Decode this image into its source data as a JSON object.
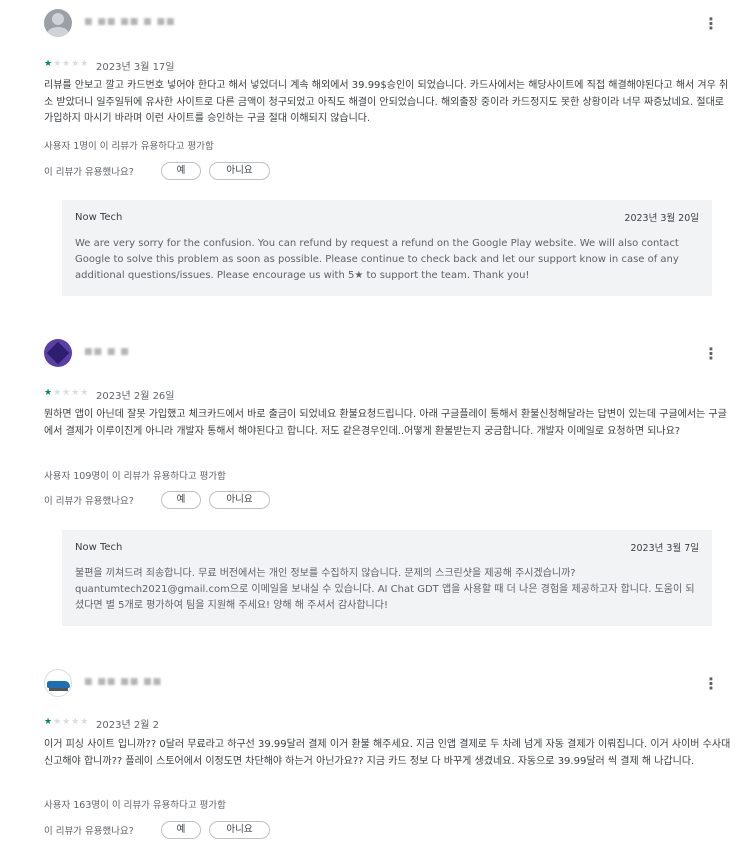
{
  "reviews": [
    {
      "username": "■ ■■ ■■ ■ ■■",
      "rating": 1,
      "date": "2023년 3월 17일",
      "text": "리뷰를 안보고 깔고 카드번호 넣어야 한다고 해서 넣었더니 계속 해외에서 39.99$승인이 되었습니다. 카드사에서는 해당사이트에 직접 해결해야된다고 해서 겨우 취소 받았더니 일주일뒤에 유사한 사이트로 다른 금액이 청구되었고 아직도 해결이 안되었습니다. 해외출장 중이라 카드정지도 못한 상황이라 너무 짜증났네요. 절대로 가입하지 마시기 바라며 이런 사이트를 승인하는 구글 절대 이해되지 않습니다.",
      "helpful_count_text": "사용자 1명이 이 리뷰가 유용하다고 평가함",
      "helpful_question": "이 리뷰가 유용했나요?",
      "yes_label": "예",
      "no_label": "아니요",
      "reply": {
        "developer": "Now Tech",
        "date": "2023년 3월 20일",
        "text": "We are very sorry for the confusion. You can refund by request a refund on the Google Play website. We will also contact Google to solve this problem as soon as possible. Please continue to check back and let our support know in case of any additional questions/issues. Please encourage us with 5★ to support the team. Thank you!"
      }
    },
    {
      "username": "■■ ■ ■",
      "rating": 1,
      "date": "2023년 2월 26일",
      "text": "뭔하면 앱이 아닌데 잘못 가입했고 체크카드에서 바로 출금이 되었네요 환불요청드립니다. 아래 구글플레이 통해서 환불신청해달라는 답변이 있는데 구글에서는 구글에서 결제가 이루이진게 아니라 개발자 통해서 해야된다고 합니다. 저도 같은경우인데..어떻게 환불받는지 궁금합니다. 개발자 이메일로 요청하면 되나요?",
      "helpful_count_text": "사용자 109명이 이 리뷰가 유용하다고 평가함",
      "helpful_question": "이 리뷰가 유용했나요?",
      "yes_label": "예",
      "no_label": "아니요",
      "reply": {
        "developer": "Now Tech",
        "date": "2023년 3월 7일",
        "text": "불편을 끼쳐드려 죄송합니다. 무료 버전에서는 개인 정보를 수집하지 않습니다. 문제의 스크린샷을 제공해 주시겠습니까? quantumtech2021@gmail.com으로 이메일을 보내실 수 있습니다. AI Chat GDT 앱을 사용할 때 더 나은 경험을 제공하고자 합니다. 도움이 되셨다면 별 5개로 평가하여 팀을 지원해 주세요! 양해 해 주셔서 감사합니다!"
      }
    },
    {
      "username": "■ ■■ ■■ ■■",
      "rating": 1,
      "date": "2023년 2월 2",
      "text": "이거 피싱 사이트 입니까?? 0달러 무료라고 하구선 39.99달러 결제 이거 환불 해주세요. 지금 인앱 결제로 두 차례 넘게 자동 결제가 이뤄집니다. 이거 사이버 수사대 신고해야 합니까?? 플레이 스토어에서 이정도면 차단해야 하는거 아닌가요?? 지금 카드 정보 다 바꾸게 생겼네요. 자동으로 39.99달러 씩 결제 해 나갑니다.",
      "helpful_count_text": "사용자 163명이 이 리뷰가 유용하다고 평가함",
      "helpful_question": "이 리뷰가 유용했나요?",
      "yes_label": "예",
      "no_label": "아니요"
    }
  ],
  "icons": {
    "more": "more-vert-icon",
    "star_filled": "★",
    "star_empty": "★"
  },
  "colors": {
    "star_accent": "#01875f",
    "reply_background": "#f1f3f4"
  }
}
